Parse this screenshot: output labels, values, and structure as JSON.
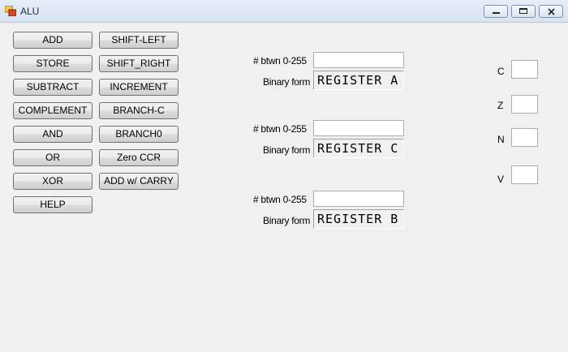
{
  "window": {
    "title": "ALU"
  },
  "buttons": {
    "add": "ADD",
    "shift_left": "SHIFT-LEFT",
    "store": "STORE",
    "shift_right": "SHIFT_RIGHT",
    "subtract": "SUBTRACT",
    "increment": "INCREMENT",
    "complement": "COMPLEMENT",
    "branch_c": "BRANCH-C",
    "and": "AND",
    "branch0": "BRANCH0",
    "or": "OR",
    "zero_ccr": "Zero CCR",
    "xor": "XOR",
    "add_carry": "ADD w/ CARRY",
    "help": "HELP"
  },
  "registers": [
    {
      "number_label": "# btwn 0-255",
      "number_value": "",
      "binary_label": "Binary form",
      "register_text": "REGISTER A"
    },
    {
      "number_label": "# btwn 0-255",
      "number_value": "",
      "binary_label": "Binary form",
      "register_text": "REGISTER C"
    },
    {
      "number_label": "# btwn 0-255",
      "number_value": "",
      "binary_label": "Binary form",
      "register_text": "REGISTER B"
    }
  ],
  "flags": [
    {
      "label": "C",
      "value": ""
    },
    {
      "label": "Z",
      "value": ""
    },
    {
      "label": "N",
      "value": ""
    },
    {
      "label": "V",
      "value": ""
    }
  ]
}
